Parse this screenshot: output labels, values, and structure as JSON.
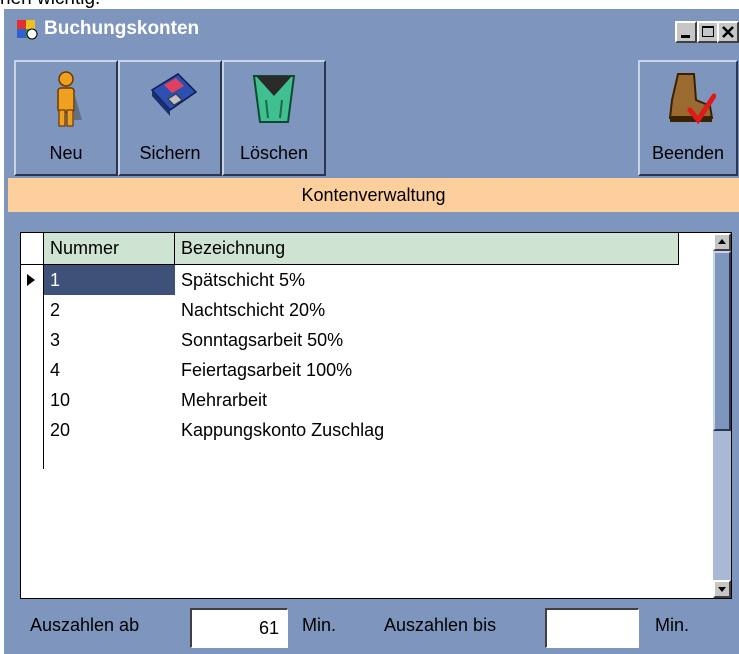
{
  "top_fragment": "nen wichtig.",
  "window": {
    "title": "Buchungskonten",
    "controls": {
      "minimize": "_",
      "maximize": "□",
      "close": "×"
    }
  },
  "toolbar": {
    "new_label": "Neu",
    "save_label": "Sichern",
    "delete_label": "Löschen",
    "exit_label": "Beenden"
  },
  "section_title": "Kontenverwaltung",
  "table": {
    "columns": [
      "Nummer",
      "Bezeichnung"
    ],
    "rows": [
      {
        "nummer": "1",
        "bezeichnung": "Spätschicht 5%"
      },
      {
        "nummer": "2",
        "bezeichnung": "Nachtschicht 20%"
      },
      {
        "nummer": "3",
        "bezeichnung": "Sonntagsarbeit 50%"
      },
      {
        "nummer": "4",
        "bezeichnung": "Feiertagsarbeit 100%"
      },
      {
        "nummer": "10",
        "bezeichnung": "Mehrarbeit"
      },
      {
        "nummer": "20",
        "bezeichnung": "Kappungskonto Zuschlag"
      }
    ],
    "selected_row": 0
  },
  "footer": {
    "from_label": "Auszahlen ab",
    "from_value": "61",
    "from_unit": "Min.",
    "to_label": "Auszahlen bis",
    "to_value": "",
    "to_unit": "Min."
  },
  "colors": {
    "window_bg": "#7e95bd",
    "section_header_bg": "#fdcf9c",
    "table_header_bg": "#cfe3d3",
    "selection_bg": "#3d5179"
  }
}
